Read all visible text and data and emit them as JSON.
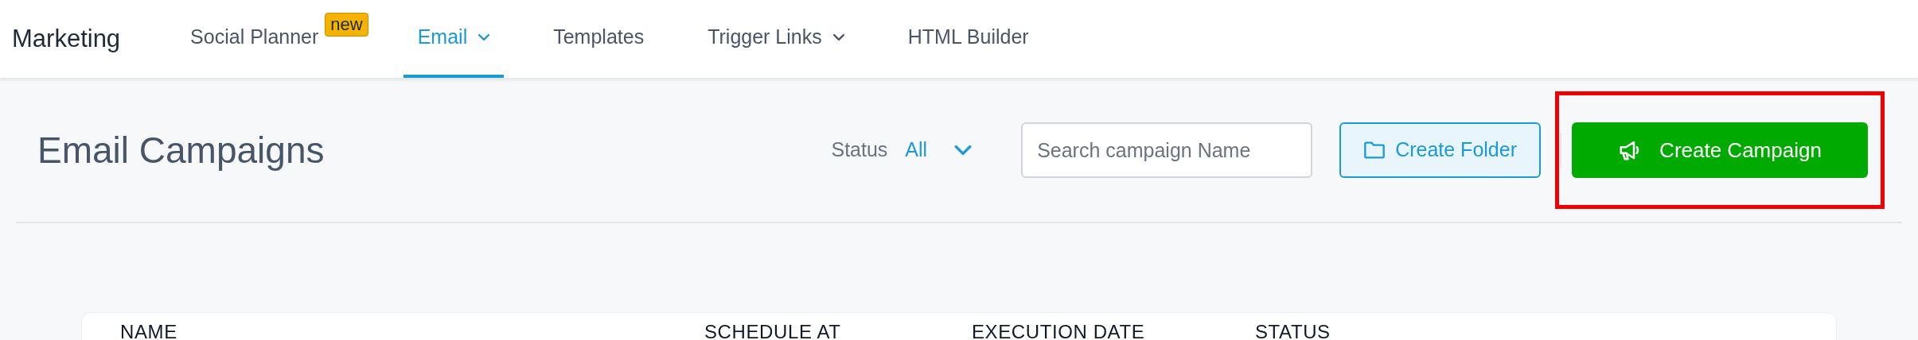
{
  "app_title": "Marketing",
  "nav_tabs": [
    {
      "label": "Social Planner",
      "selected": false,
      "badge": "new",
      "dropdown": false
    },
    {
      "label": "Email",
      "selected": true,
      "dropdown": true
    },
    {
      "label": "Templates",
      "selected": false,
      "dropdown": false
    },
    {
      "label": "Trigger Links",
      "selected": false,
      "dropdown": true
    },
    {
      "label": "HTML Builder",
      "selected": false,
      "dropdown": false
    }
  ],
  "page_title": "Email Campaigns",
  "status_filter": {
    "label": "Status",
    "value": "All"
  },
  "search": {
    "placeholder": "Search campaign Name"
  },
  "create_folder_button": "Create Folder",
  "create_campaign_button": {
    "label": "Create Campaign",
    "highlighted": true
  },
  "table": {
    "columns": [
      "NAME",
      "SCHEDULE AT",
      "EXECUTION DATE",
      "STATUS"
    ]
  }
}
